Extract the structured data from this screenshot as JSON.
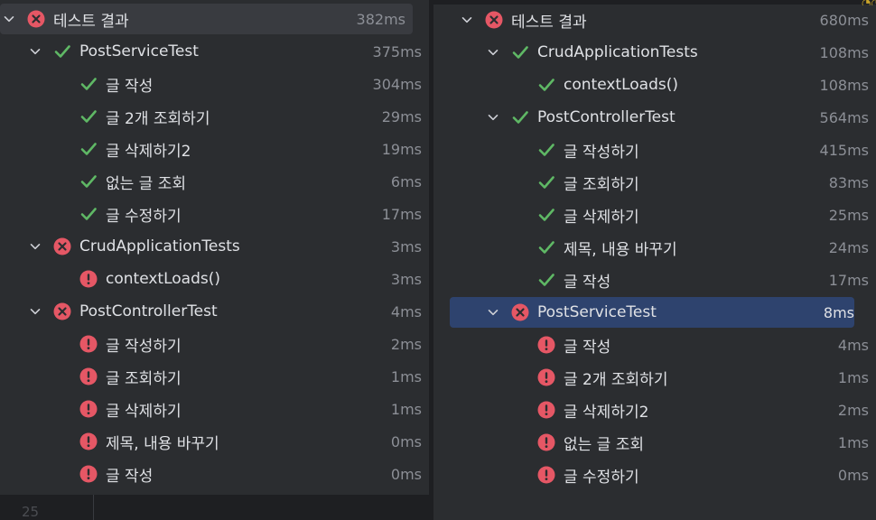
{
  "left": {
    "rows": [
      {
        "level": 0,
        "arrow": true,
        "status": "fail",
        "label": "테스트 결과",
        "time": "382ms",
        "hover": true
      },
      {
        "level": 1,
        "arrow": true,
        "status": "pass",
        "label": "PostServiceTest",
        "time": "375ms"
      },
      {
        "level": 2,
        "arrow": false,
        "status": "pass",
        "label": "글 작성",
        "time": "304ms"
      },
      {
        "level": 2,
        "arrow": false,
        "status": "pass",
        "label": "글 2개 조회하기",
        "time": "29ms"
      },
      {
        "level": 2,
        "arrow": false,
        "status": "pass",
        "label": "글 삭제하기2",
        "time": "19ms"
      },
      {
        "level": 2,
        "arrow": false,
        "status": "pass",
        "label": "없는 글 조회",
        "time": "6ms"
      },
      {
        "level": 2,
        "arrow": false,
        "status": "pass",
        "label": "글 수정하기",
        "time": "17ms"
      },
      {
        "level": 1,
        "arrow": true,
        "status": "fail",
        "label": "CrudApplicationTests",
        "time": "3ms"
      },
      {
        "level": 2,
        "arrow": false,
        "status": "error",
        "label": "contextLoads()",
        "time": "3ms"
      },
      {
        "level": 1,
        "arrow": true,
        "status": "fail",
        "label": "PostControllerTest",
        "time": "4ms"
      },
      {
        "level": 2,
        "arrow": false,
        "status": "error",
        "label": "글 작성하기",
        "time": "2ms"
      },
      {
        "level": 2,
        "arrow": false,
        "status": "error",
        "label": "글 조회하기",
        "time": "1ms"
      },
      {
        "level": 2,
        "arrow": false,
        "status": "error",
        "label": "글 삭제하기",
        "time": "1ms"
      },
      {
        "level": 2,
        "arrow": false,
        "status": "error",
        "label": "제목, 내용 바꾸기",
        "time": "0ms"
      },
      {
        "level": 2,
        "arrow": false,
        "status": "error",
        "label": "글 작성",
        "time": "0ms"
      }
    ]
  },
  "right": {
    "rows": [
      {
        "level": 0,
        "arrow": true,
        "status": "fail",
        "label": "테스트 결과",
        "time": "680ms"
      },
      {
        "level": 1,
        "arrow": true,
        "status": "pass",
        "label": "CrudApplicationTests",
        "time": "108ms"
      },
      {
        "level": 2,
        "arrow": false,
        "status": "pass",
        "label": "contextLoads()",
        "time": "108ms"
      },
      {
        "level": 1,
        "arrow": true,
        "status": "pass",
        "label": "PostControllerTest",
        "time": "564ms"
      },
      {
        "level": 2,
        "arrow": false,
        "status": "pass",
        "label": "글 작성하기",
        "time": "415ms"
      },
      {
        "level": 2,
        "arrow": false,
        "status": "pass",
        "label": "글 조회하기",
        "time": "83ms"
      },
      {
        "level": 2,
        "arrow": false,
        "status": "pass",
        "label": "글 삭제하기",
        "time": "25ms"
      },
      {
        "level": 2,
        "arrow": false,
        "status": "pass",
        "label": "제목, 내용 바꾸기",
        "time": "24ms"
      },
      {
        "level": 2,
        "arrow": false,
        "status": "pass",
        "label": "글 작성",
        "time": "17ms"
      },
      {
        "level": 1,
        "arrow": true,
        "status": "fail",
        "label": "PostServiceTest",
        "time": "8ms",
        "selected": true
      },
      {
        "level": 2,
        "arrow": false,
        "status": "error",
        "label": "글 작성",
        "time": "4ms"
      },
      {
        "level": 2,
        "arrow": false,
        "status": "error",
        "label": "글 2개 조회하기",
        "time": "1ms"
      },
      {
        "level": 2,
        "arrow": false,
        "status": "error",
        "label": "글 삭제하기2",
        "time": "2ms"
      },
      {
        "level": 2,
        "arrow": false,
        "status": "error",
        "label": "없는 글 조회",
        "time": "1ms"
      },
      {
        "level": 2,
        "arrow": false,
        "status": "error",
        "label": "글 수정하기",
        "time": "0ms"
      }
    ]
  },
  "gutter": {
    "line_number": "25"
  },
  "colors": {
    "pass": "#5fb865",
    "fail": "#e55765",
    "error": "#e55765",
    "selection": "#2e436e"
  },
  "icons": {
    "pass": "check-icon",
    "fail": "fail-circle-icon",
    "error": "error-exclamation-icon",
    "arrow": "chevron-down-icon"
  }
}
